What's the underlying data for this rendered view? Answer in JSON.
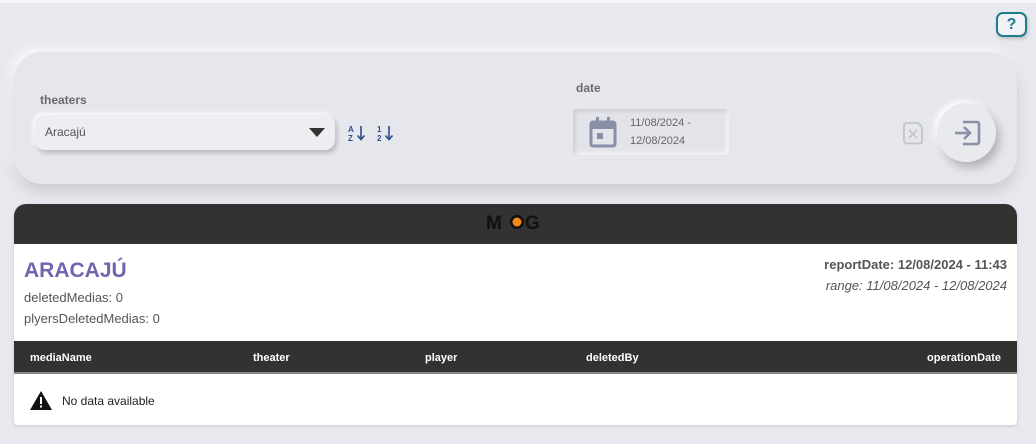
{
  "help": {
    "label": "?"
  },
  "filters": {
    "theaters_label": "theaters",
    "theater_value": "Aracajú",
    "date_label": "date",
    "date_start": "11/08/2024 -",
    "date_end": "12/08/2024"
  },
  "report": {
    "logo": "MOG",
    "title": "ARACAJÚ",
    "deleted_medias": "deletedMedias: 0",
    "players_deleted_medias": "plyersDeletedMedias: 0",
    "report_date": "reportDate: 12/08/2024 - 11:43",
    "range": "range: 11/08/2024 - 12/08/2024",
    "columns": [
      "mediaName",
      "theater",
      "player",
      "deletedBy",
      "operationDate"
    ],
    "empty_message": "No data available"
  },
  "colors": {
    "accent": "#7165b0",
    "help": "#1e7b8c",
    "header_bg": "#323232",
    "logo_orange": "#f28a1a"
  }
}
